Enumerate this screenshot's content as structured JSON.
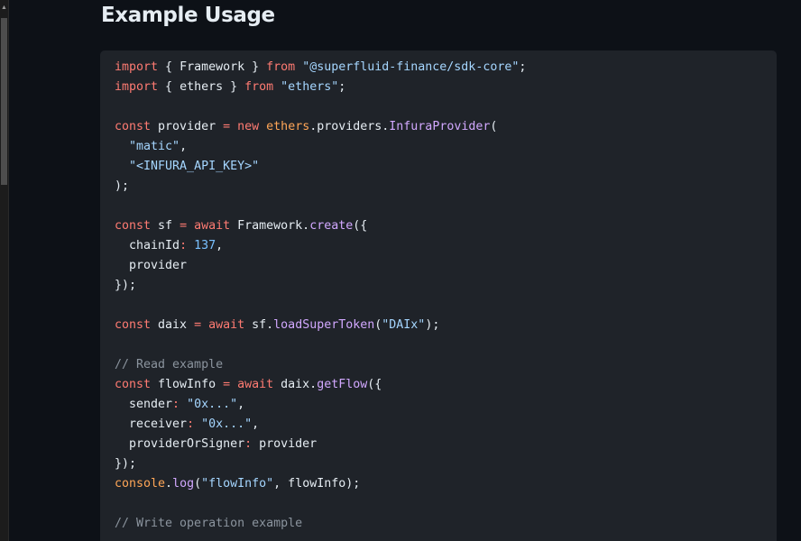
{
  "page": {
    "heading": "Example Usage",
    "scroll_up_icon": "triangle-up-icon"
  },
  "code": {
    "language": "javascript",
    "lines": [
      [
        {
          "t": "import",
          "c": "k"
        },
        {
          "t": " { Framework } ",
          "c": "p"
        },
        {
          "t": "from",
          "c": "k"
        },
        {
          "t": " ",
          "c": "p"
        },
        {
          "t": "\"@superfluid-finance/sdk-core\"",
          "c": "s"
        },
        {
          "t": ";",
          "c": "p"
        }
      ],
      [
        {
          "t": "import",
          "c": "k"
        },
        {
          "t": " { ethers } ",
          "c": "p"
        },
        {
          "t": "from",
          "c": "k"
        },
        {
          "t": " ",
          "c": "p"
        },
        {
          "t": "\"ethers\"",
          "c": "s"
        },
        {
          "t": ";",
          "c": "p"
        }
      ],
      [],
      [
        {
          "t": "const",
          "c": "k"
        },
        {
          "t": " provider ",
          "c": "p"
        },
        {
          "t": "=",
          "c": "k"
        },
        {
          "t": " ",
          "c": "p"
        },
        {
          "t": "new",
          "c": "k"
        },
        {
          "t": " ",
          "c": "p"
        },
        {
          "t": "ethers",
          "c": "v"
        },
        {
          "t": ".providers.",
          "c": "p"
        },
        {
          "t": "InfuraProvider",
          "c": "f"
        },
        {
          "t": "(",
          "c": "p"
        }
      ],
      [
        {
          "t": "  ",
          "c": "p"
        },
        {
          "t": "\"matic\"",
          "c": "s"
        },
        {
          "t": ",",
          "c": "p"
        }
      ],
      [
        {
          "t": "  ",
          "c": "p"
        },
        {
          "t": "\"<INFURA_API_KEY>\"",
          "c": "s"
        }
      ],
      [
        {
          "t": ");",
          "c": "p"
        }
      ],
      [],
      [
        {
          "t": "const",
          "c": "k"
        },
        {
          "t": " sf ",
          "c": "p"
        },
        {
          "t": "=",
          "c": "k"
        },
        {
          "t": " ",
          "c": "p"
        },
        {
          "t": "await",
          "c": "k"
        },
        {
          "t": " Framework.",
          "c": "p"
        },
        {
          "t": "create",
          "c": "f"
        },
        {
          "t": "({",
          "c": "p"
        }
      ],
      [
        {
          "t": "  chainId",
          "c": "p"
        },
        {
          "t": ":",
          "c": "k"
        },
        {
          "t": " ",
          "c": "p"
        },
        {
          "t": "137",
          "c": "n"
        },
        {
          "t": ",",
          "c": "p"
        }
      ],
      [
        {
          "t": "  provider",
          "c": "p"
        }
      ],
      [
        {
          "t": "});",
          "c": "p"
        }
      ],
      [],
      [
        {
          "t": "const",
          "c": "k"
        },
        {
          "t": " daix ",
          "c": "p"
        },
        {
          "t": "=",
          "c": "k"
        },
        {
          "t": " ",
          "c": "p"
        },
        {
          "t": "await",
          "c": "k"
        },
        {
          "t": " sf.",
          "c": "p"
        },
        {
          "t": "loadSuperToken",
          "c": "f"
        },
        {
          "t": "(",
          "c": "p"
        },
        {
          "t": "\"DAIx\"",
          "c": "s"
        },
        {
          "t": ");",
          "c": "p"
        }
      ],
      [],
      [
        {
          "t": "// Read example",
          "c": "c"
        }
      ],
      [
        {
          "t": "const",
          "c": "k"
        },
        {
          "t": " flowInfo ",
          "c": "p"
        },
        {
          "t": "=",
          "c": "k"
        },
        {
          "t": " ",
          "c": "p"
        },
        {
          "t": "await",
          "c": "k"
        },
        {
          "t": " daix.",
          "c": "p"
        },
        {
          "t": "getFlow",
          "c": "f"
        },
        {
          "t": "({",
          "c": "p"
        }
      ],
      [
        {
          "t": "  sender",
          "c": "p"
        },
        {
          "t": ":",
          "c": "k"
        },
        {
          "t": " ",
          "c": "p"
        },
        {
          "t": "\"0x...\"",
          "c": "s"
        },
        {
          "t": ",",
          "c": "p"
        }
      ],
      [
        {
          "t": "  receiver",
          "c": "p"
        },
        {
          "t": ":",
          "c": "k"
        },
        {
          "t": " ",
          "c": "p"
        },
        {
          "t": "\"0x...\"",
          "c": "s"
        },
        {
          "t": ",",
          "c": "p"
        }
      ],
      [
        {
          "t": "  providerOrSigner",
          "c": "p"
        },
        {
          "t": ":",
          "c": "k"
        },
        {
          "t": " provider",
          "c": "p"
        }
      ],
      [
        {
          "t": "});",
          "c": "p"
        }
      ],
      [
        {
          "t": "console",
          "c": "v"
        },
        {
          "t": ".",
          "c": "p"
        },
        {
          "t": "log",
          "c": "f"
        },
        {
          "t": "(",
          "c": "p"
        },
        {
          "t": "\"flowInfo\"",
          "c": "s"
        },
        {
          "t": ", flowInfo);",
          "c": "p"
        }
      ],
      [],
      [
        {
          "t": "// Write operation example",
          "c": "c"
        }
      ]
    ]
  }
}
